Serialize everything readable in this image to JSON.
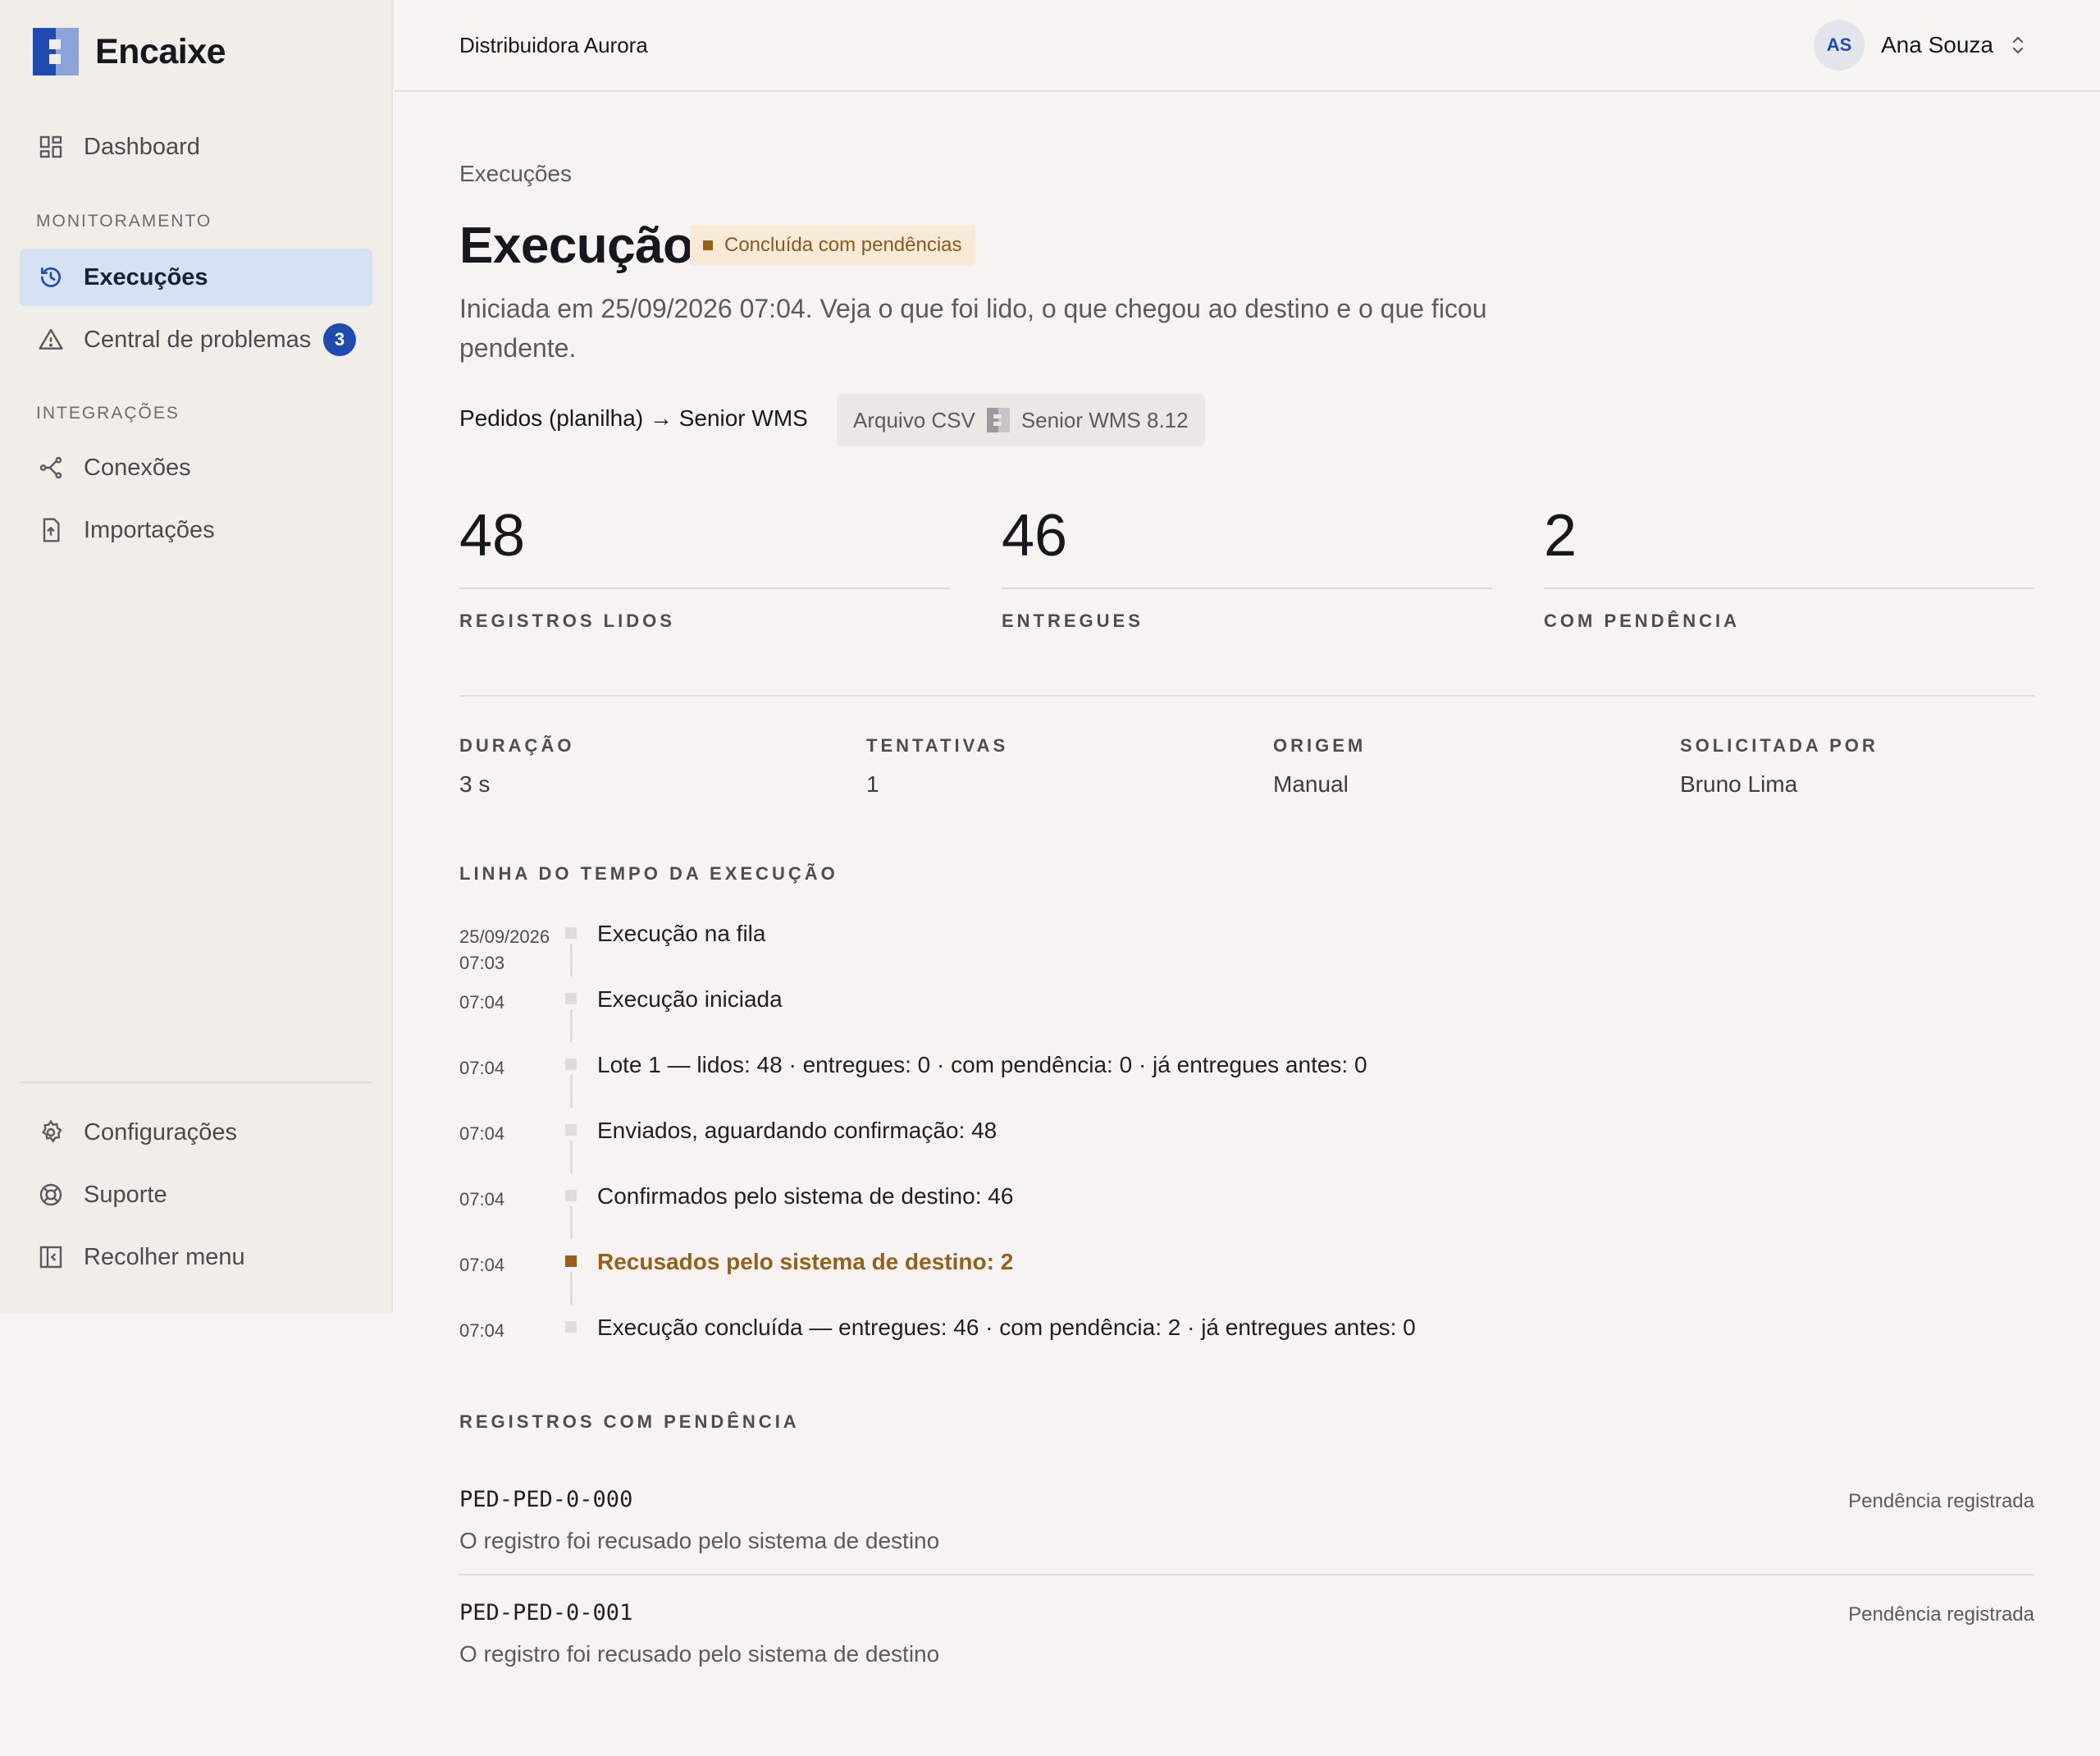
{
  "app": {
    "name": "Encaixe",
    "brand_color": "#1e4bb0"
  },
  "sidebar": {
    "dashboard": {
      "label": "Dashboard",
      "icon": "dashboard-icon"
    },
    "section_monitoring": "MONITORAMENTO",
    "executions": {
      "label": "Execuções",
      "icon": "history-icon"
    },
    "problems": {
      "label": "Central de problemas",
      "icon": "warning-icon",
      "badge": "3"
    },
    "section_integrations": "INTEGRAÇÕES",
    "connections": {
      "label": "Conexões",
      "icon": "connections-icon"
    },
    "imports": {
      "label": "Importações",
      "icon": "file-upload-icon"
    },
    "settings": {
      "label": "Configurações",
      "icon": "gear-icon"
    },
    "support": {
      "label": "Suporte",
      "icon": "lifebuoy-icon"
    },
    "collapse": {
      "label": "Recolher menu",
      "icon": "collapse-sidebar-icon"
    }
  },
  "topbar": {
    "org": "Distribuidora Aurora",
    "user_initials": "AS",
    "user_name": "Ana Souza"
  },
  "page": {
    "breadcrumb": "Execuções",
    "title": "Execução",
    "status": "Concluída com pendências",
    "status_color": "#9a5f19",
    "subtitle": "Iniciada em 25/09/2026 07:04. Veja o que foi lido, o que chegou ao destino e o que ficou pendente.",
    "flow": "Pedidos (planilha) → Senior WMS",
    "flow_source": "Arquivo CSV",
    "flow_target": "Senior WMS 8.12"
  },
  "metrics": [
    {
      "value": "48",
      "label": "REGISTROS LIDOS"
    },
    {
      "value": "46",
      "label": "ENTREGUES"
    },
    {
      "value": "2",
      "label": "COM PENDÊNCIA"
    }
  ],
  "meta": [
    {
      "key": "DURAÇÃO",
      "value": "3 s"
    },
    {
      "key": "TENTATIVAS",
      "value": "1"
    },
    {
      "key": "ORIGEM",
      "value": "Manual"
    },
    {
      "key": "SOLICITADA POR",
      "value": "Bruno Lima"
    }
  ],
  "timeline": {
    "title": "LINHA DO TEMPO DA EXECUÇÃO",
    "events": [
      {
        "time": "25/09/2026\n07:03",
        "text": "Execução na fila",
        "warn": false
      },
      {
        "time": "07:04",
        "text": "Execução iniciada",
        "warn": false
      },
      {
        "time": "07:04",
        "text": "Lote 1 — lidos: 48 · entregues: 0 · com pendência: 0 · já entregues antes: 0",
        "warn": false
      },
      {
        "time": "07:04",
        "text": "Enviados, aguardando confirmação: 48",
        "warn": false
      },
      {
        "time": "07:04",
        "text": "Confirmados pelo sistema de destino: 46",
        "warn": false
      },
      {
        "time": "07:04",
        "text": "Recusados pelo sistema de destino: 2",
        "warn": true
      },
      {
        "time": "07:04",
        "text": "Execução concluída — entregues: 46 · com pendência: 2 · já entregues antes: 0",
        "warn": false
      }
    ]
  },
  "pending": {
    "title": "REGISTROS COM PENDÊNCIA",
    "items": [
      {
        "id": "PED-PED-0-000",
        "description": "O registro foi recusado pelo sistema de destino",
        "status": "Pendência registrada"
      },
      {
        "id": "PED-PED-0-001",
        "description": "O registro foi recusado pelo sistema de destino",
        "status": "Pendência registrada"
      }
    ]
  }
}
